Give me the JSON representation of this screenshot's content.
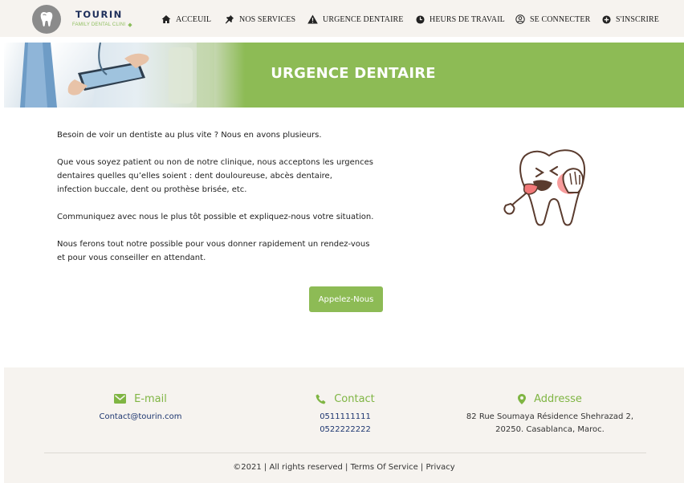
{
  "brand": {
    "name": "TOURIN",
    "tagline": "FAMILY DENTAL CLINI"
  },
  "nav": {
    "items": [
      {
        "label": "ACCEUIL",
        "icon": "home-icon"
      },
      {
        "label": "NOS SERVICES",
        "icon": "pin-icon"
      },
      {
        "label": "URGENCE DENTAIRE",
        "icon": "warning-icon"
      },
      {
        "label": "HEURS DE TRAVAIL",
        "icon": "clock-icon"
      },
      {
        "label": "SE CONNECTER",
        "icon": "user-circle-icon"
      },
      {
        "label": "S'INSCRIRE",
        "icon": "plus-circle-icon"
      }
    ]
  },
  "hero": {
    "title": "URGENCE DENTAIRE"
  },
  "content": {
    "paragraphs": [
      "Besoin de voir un dentiste au plus vite ? Nous en avons plusieurs.",
      "Que vous soyez patient ou non de notre clinique, nous acceptons les urgences\ndentaires quelles qu’elles soient : dent douloureuse, abcès dentaire,\ninfection buccale, dent ou prothèse brisée, etc.",
      "Communiquez avec nous le plus tôt possible et expliquez-nous votre situation.",
      "Nous ferons tout notre possible pour vous donner rapidement un rendez-vous\net pour vous conseiller en attendant."
    ],
    "cta_label": "Appelez-Nous"
  },
  "footer": {
    "email": {
      "title": "E-mail",
      "value": "Contact@tourin.com"
    },
    "contact": {
      "title": "Contact",
      "phone1": "0511111111",
      "phone2": "0522222222"
    },
    "address": {
      "title": "Addresse",
      "line1": "82 Rue Soumaya Résidence Shehrazad 2,",
      "line2": "20250. Casablanca, Maroc."
    },
    "copyright": "©2021 | All rights reserved | Terms Of Service | Privacy"
  },
  "colors": {
    "accent_green": "#8dbb55",
    "nav_background": "#f6f3ef",
    "link_blue": "#1d3670",
    "brand_navy": "#1d2e5a"
  }
}
